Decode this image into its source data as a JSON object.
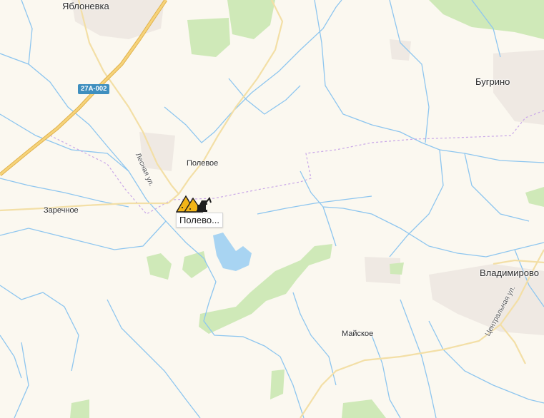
{
  "map": {
    "colors": {
      "background": "#fbf8f0",
      "water": "#a8d4f2",
      "river": "#8ec6ef",
      "forest": "#cfe9b8",
      "major_road": "#f2c86d",
      "road": "#f3dfa6",
      "settlement": "#efe9e3",
      "boundary": "#c9a7e8"
    },
    "places": {
      "yablonevka": "Яблоневка",
      "bugrino": "Бугрино",
      "polevoe": "Полевое",
      "zarechnoe": "Заречное",
      "vladimirovo": "Владимирово",
      "maiskoe": "Майское"
    },
    "streets": {
      "lesnaya": "Лесная ул.",
      "centralnaya": "Центральная ул."
    },
    "road_shield": "27А-002",
    "poi": {
      "icon": "quarry-excavator-icon",
      "label": "Полево..."
    }
  }
}
